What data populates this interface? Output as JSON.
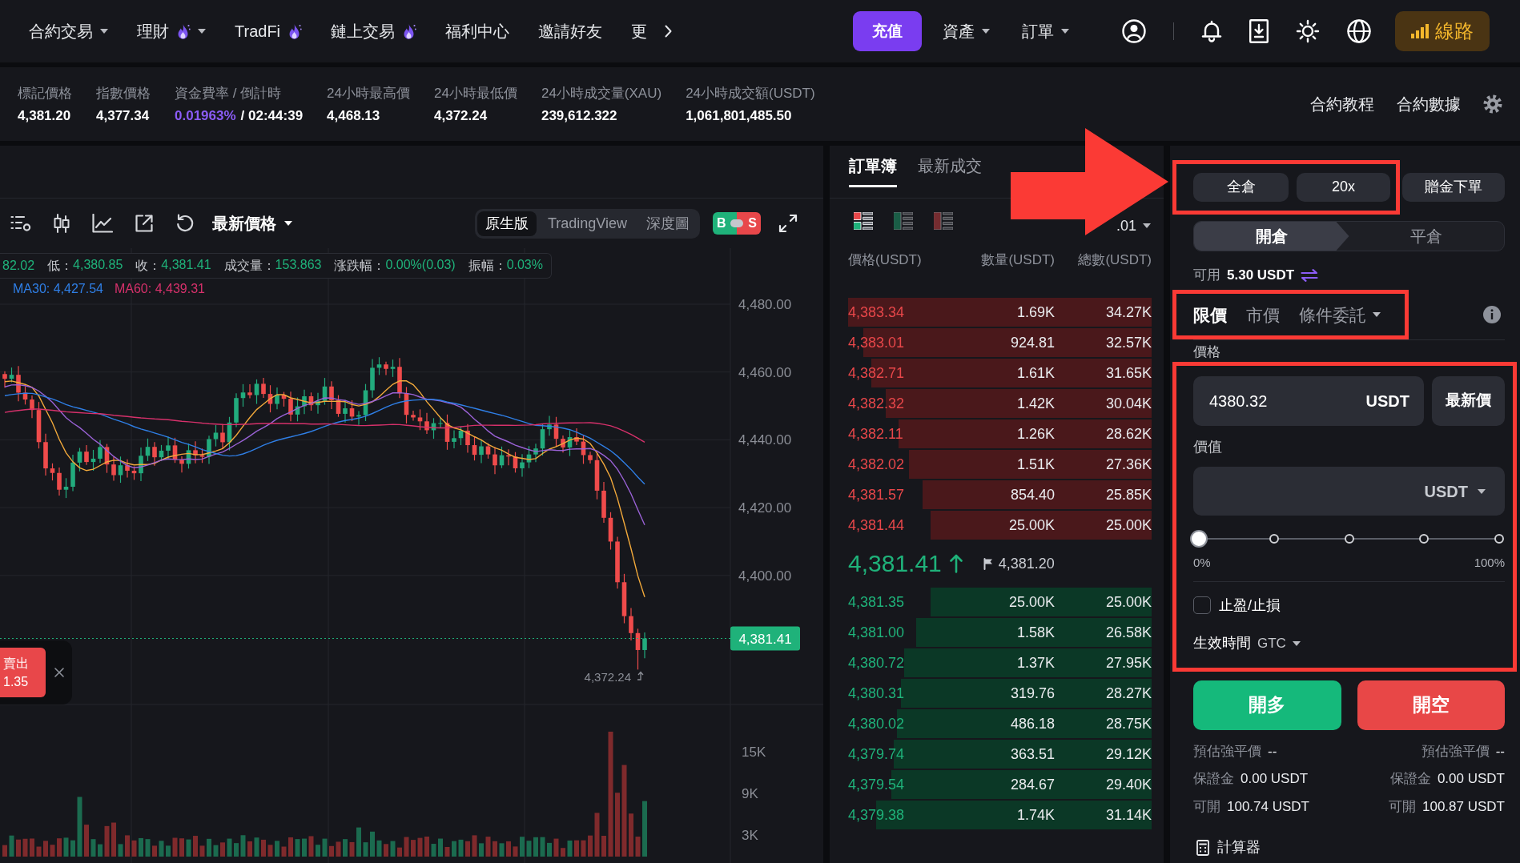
{
  "nav": {
    "menu": [
      {
        "label": "合約交易",
        "hot": false,
        "dropdown": true
      },
      {
        "label": "理財",
        "hot": true,
        "dropdown": true
      },
      {
        "label": "TradFi",
        "hot": true,
        "dropdown": false
      },
      {
        "label": "鏈上交易",
        "hot": true,
        "dropdown": false
      },
      {
        "label": "福利中心",
        "hot": false,
        "dropdown": false
      },
      {
        "label": "邀請好友",
        "hot": false,
        "dropdown": false
      },
      {
        "label": "更",
        "hot": false,
        "dropdown": false
      }
    ],
    "deposit_button": "充值",
    "account_menus": [
      {
        "label": "資產",
        "dropdown": true
      },
      {
        "label": "訂單",
        "dropdown": true
      }
    ],
    "route_button": "線路"
  },
  "stats": [
    {
      "kind": "plain",
      "label": "標記價格",
      "value": "4,381.20"
    },
    {
      "kind": "plain",
      "label": "指數價格",
      "value": "4,377.34"
    },
    {
      "kind": "funding",
      "label": "資金費率 / 倒計時",
      "rate": "0.01963%",
      "separator": "/",
      "countdown": "02:44:39"
    },
    {
      "kind": "plain",
      "label": "24小時最高價",
      "value": "4,468.13"
    },
    {
      "kind": "plain",
      "label": "24小時最低價",
      "value": "4,372.24"
    },
    {
      "kind": "plain",
      "label": "24小時成交量(XAU)",
      "value": "239,612.322"
    },
    {
      "kind": "plain",
      "label": "24小時成交額(USDT)",
      "value": "1,061,801,485.50"
    }
  ],
  "stats_links": [
    "合約教程",
    "合約數據"
  ],
  "chart": {
    "toolbar": {
      "price_type": "最新價格",
      "views": [
        {
          "label": "原生版",
          "selected": true
        },
        {
          "label": "TradingView",
          "selected": false
        },
        {
          "label": "深度圖",
          "selected": false
        }
      ],
      "bs_toggle": {
        "buy": "B",
        "sell": "S"
      }
    },
    "ohlc": [
      {
        "value": "82.02"
      },
      {
        "label": "低：",
        "value": "4,380.85"
      },
      {
        "label": "收：",
        "value": "4,381.41"
      },
      {
        "label": "成交量：",
        "value": "153.863"
      },
      {
        "label": "涨跌幅：",
        "value": "0.00%(0.03)"
      },
      {
        "label": "振幅：",
        "value": "0.03%"
      }
    ],
    "moving_averages": [
      {
        "label": "MA30: 4,427.54",
        "color": "#2f7fe6"
      },
      {
        "label": "MA60: 4,439.31",
        "color": "#d6316b"
      }
    ],
    "price_ticks": [
      "4,480.00",
      "4,460.00",
      "4,440.00",
      "4,420.00",
      "4,400.00"
    ],
    "last_price_tag": "4,381.41",
    "low_marker": "4,372.24",
    "volume_ticks": [
      "15K",
      "9K",
      "3K"
    ],
    "order_card": {
      "side": "賣出",
      "price": "1.35"
    }
  },
  "order_book": {
    "tabs": [
      {
        "label": "訂單簿",
        "selected": true
      },
      {
        "label": "最新成交",
        "selected": false
      }
    ],
    "depth_views": [
      {
        "kind": "both",
        "selected": true
      },
      {
        "kind": "bids",
        "selected": false
      },
      {
        "kind": "asks",
        "selected": false
      }
    ],
    "precision": ".01",
    "columns": [
      "價格(USDT)",
      "數量(USDT)",
      "總數(USDT)"
    ],
    "asks": [
      {
        "price": "4,383.34",
        "amount": "1.69K",
        "total": "34.27K"
      },
      {
        "price": "4,383.01",
        "amount": "924.81",
        "total": "32.57K"
      },
      {
        "price": "4,382.71",
        "amount": "1.61K",
        "total": "31.65K"
      },
      {
        "price": "4,382.32",
        "amount": "1.42K",
        "total": "30.04K"
      },
      {
        "price": "4,382.11",
        "amount": "1.26K",
        "total": "28.62K"
      },
      {
        "price": "4,382.02",
        "amount": "1.51K",
        "total": "27.36K"
      },
      {
        "price": "4,381.57",
        "amount": "854.40",
        "total": "25.85K"
      },
      {
        "price": "4,381.44",
        "amount": "25.00K",
        "total": "25.00K"
      }
    ],
    "last_price": {
      "value": "4,381.41",
      "rising": true
    },
    "mark_price": "4,381.20",
    "bids": [
      {
        "price": "4,381.35",
        "amount": "25.00K",
        "total": "25.00K"
      },
      {
        "price": "4,381.00",
        "amount": "1.58K",
        "total": "26.58K"
      },
      {
        "price": "4,380.72",
        "amount": "1.37K",
        "total": "27.95K"
      },
      {
        "price": "4,380.31",
        "amount": "319.76",
        "total": "28.27K"
      },
      {
        "price": "4,380.02",
        "amount": "486.18",
        "total": "28.75K"
      },
      {
        "price": "4,379.74",
        "amount": "363.51",
        "total": "29.12K"
      },
      {
        "price": "4,379.54",
        "amount": "284.67",
        "total": "29.40K"
      },
      {
        "price": "4,379.38",
        "amount": "1.74K",
        "total": "31.14K"
      }
    ]
  },
  "order_form": {
    "margin_mode": "全倉",
    "leverage": "20x",
    "bonus_button": "贈金下單",
    "position_tabs": [
      {
        "label": "開倉",
        "selected": true
      },
      {
        "label": "平倉",
        "selected": false
      }
    ],
    "available": {
      "label": "可用",
      "value": "5.30 USDT"
    },
    "order_types": [
      {
        "label": "限價",
        "selected": true,
        "dropdown": false
      },
      {
        "label": "市價",
        "selected": false,
        "dropdown": false
      },
      {
        "label": "條件委託",
        "selected": false,
        "dropdown": true
      }
    ],
    "price_label": "價格",
    "price_field": {
      "value": "4380.32",
      "unit": "USDT"
    },
    "latest_price_button": "最新價",
    "value_label": "價值",
    "value_field": {
      "unit": "USDT"
    },
    "slider": {
      "level": 0,
      "min_label": "0%",
      "max_label": "100%"
    },
    "tp_sl": {
      "label": "止盈/止損",
      "checked": false
    },
    "time_in_force": {
      "label": "生效時間",
      "value": "GTC"
    },
    "long_button": "開多",
    "short_button": "開空",
    "long_info": [
      {
        "label": "預估強平價",
        "value": "--"
      },
      {
        "label": "保證金",
        "value": "0.00 USDT"
      },
      {
        "label": "可開",
        "value": "100.74 USDT"
      }
    ],
    "short_info": [
      {
        "label": "預估強平價",
        "value": "--"
      },
      {
        "label": "保證金",
        "value": "0.00 USDT"
      },
      {
        "label": "可開",
        "value": "100.87 USDT"
      }
    ],
    "calculator": "計算器"
  }
}
